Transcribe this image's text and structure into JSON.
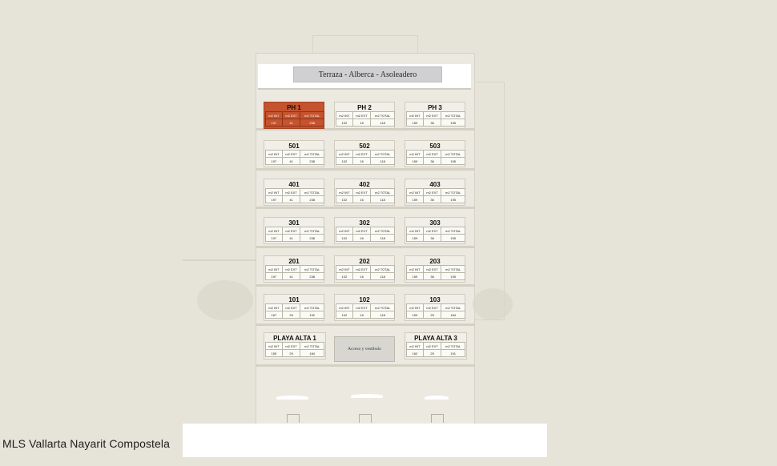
{
  "terrace_label": "Terraza - Alberca - Asoleadero",
  "lobby_label": "Acceso y vestíbulo",
  "footer_caption": "MLS Vallarta Nayarit Compostela",
  "colors": {
    "highlight": "#c5532e",
    "background": "#e6e3d8"
  },
  "units": [
    {
      "name": "PH 1",
      "h": [
        "m2 INT",
        "m2 EXT",
        "m2 TOTAL"
      ],
      "v": [
        "197",
        "41",
        "238"
      ],
      "highlight": true
    },
    {
      "name": "PH 2",
      "h": [
        "m2 INT",
        "m2 EXT",
        "m2 TOTAL"
      ],
      "v": [
        "102",
        "16",
        "118"
      ]
    },
    {
      "name": "PH 3",
      "h": [
        "m2 INT",
        "m2 EXT",
        "m2 TOTAL"
      ],
      "v": [
        "159",
        "36",
        "195"
      ]
    },
    {
      "name": "501",
      "h": [
        "m2 INT",
        "m2 EXT",
        "m2 TOTAL"
      ],
      "v": [
        "197",
        "41",
        "238"
      ]
    },
    {
      "name": "502",
      "h": [
        "m2 INT",
        "m2 EXT",
        "m2 TOTAL"
      ],
      "v": [
        "102",
        "16",
        "118"
      ]
    },
    {
      "name": "503",
      "h": [
        "m2 INT",
        "m2 EXT",
        "m2 TOTAL"
      ],
      "v": [
        "159",
        "36",
        "195"
      ]
    },
    {
      "name": "401",
      "h": [
        "m2 INT",
        "m2 EXT",
        "m2 TOTAL"
      ],
      "v": [
        "197",
        "41",
        "238"
      ]
    },
    {
      "name": "402",
      "h": [
        "m2 INT",
        "m2 EXT",
        "m2 TOTAL"
      ],
      "v": [
        "102",
        "16",
        "118"
      ]
    },
    {
      "name": "403",
      "h": [
        "m2 INT",
        "m2 EXT",
        "m2 TOTAL"
      ],
      "v": [
        "159",
        "36",
        "195"
      ]
    },
    {
      "name": "301",
      "h": [
        "m2 INT",
        "m2 EXT",
        "m2 TOTAL"
      ],
      "v": [
        "197",
        "41",
        "238"
      ]
    },
    {
      "name": "302",
      "h": [
        "m2 INT",
        "m2 EXT",
        "m2 TOTAL"
      ],
      "v": [
        "102",
        "16",
        "118"
      ]
    },
    {
      "name": "303",
      "h": [
        "m2 INT",
        "m2 EXT",
        "m2 TOTAL"
      ],
      "v": [
        "159",
        "36",
        "195"
      ]
    },
    {
      "name": "201",
      "h": [
        "m2 INT",
        "m2 EXT",
        "m2 TOTAL"
      ],
      "v": [
        "197",
        "41",
        "238"
      ]
    },
    {
      "name": "202",
      "h": [
        "m2 INT",
        "m2 EXT",
        "m2 TOTAL"
      ],
      "v": [
        "102",
        "16",
        "118"
      ]
    },
    {
      "name": "203",
      "h": [
        "m2 INT",
        "m2 EXT",
        "m2 TOTAL"
      ],
      "v": [
        "159",
        "36",
        "195"
      ]
    },
    {
      "name": "101",
      "h": [
        "m2 INT",
        "m2 EXT",
        "m2 TOTAL"
      ],
      "v": [
        "167",
        "25",
        "192"
      ]
    },
    {
      "name": "102",
      "h": [
        "m2 INT",
        "m2 EXT",
        "m2 TOTAL"
      ],
      "v": [
        "102",
        "16",
        "118"
      ]
    },
    {
      "name": "103",
      "h": [
        "m2 INT",
        "m2 EXT",
        "m2 TOTAL"
      ],
      "v": [
        "159",
        "25",
        "184"
      ]
    },
    {
      "name": "PLAYA ALTA 1",
      "h": [
        "m2 INT",
        "m2 EXT",
        "m2 TOTAL"
      ],
      "v": [
        "155",
        "29",
        "184"
      ]
    },
    {
      "name": "PLAYA ALTA 3",
      "h": [
        "m2 INT",
        "m2 EXT",
        "m2 TOTAL"
      ],
      "v": [
        "162",
        "29",
        "191"
      ]
    }
  ]
}
